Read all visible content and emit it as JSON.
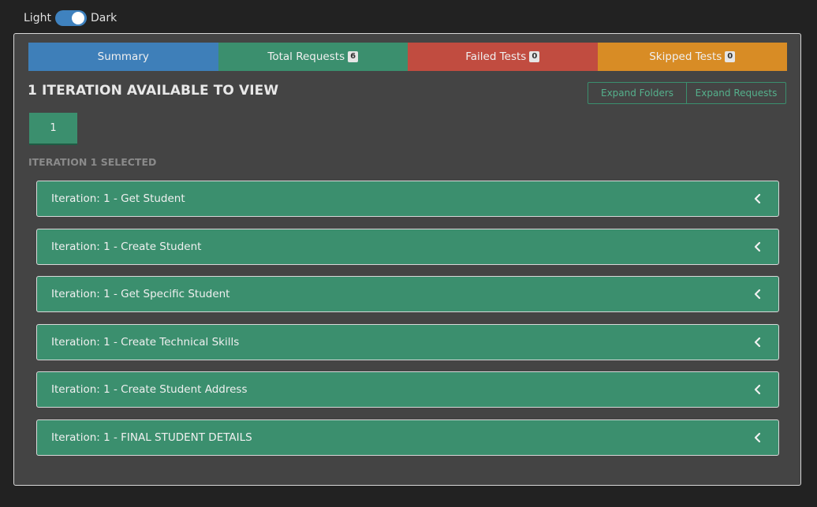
{
  "theme": {
    "light_label": "Light",
    "dark_label": "Dark",
    "dark_on": true
  },
  "tabs": {
    "summary": "Summary",
    "total_requests": "Total Requests",
    "total_requests_count": "6",
    "failed_tests": "Failed Tests",
    "failed_tests_count": "0",
    "skipped_tests": "Skipped Tests",
    "skipped_tests_count": "0"
  },
  "heading": "1 ITERATION AVAILABLE TO VIEW",
  "buttons": {
    "expand_folders": "Expand Folders",
    "expand_requests": "Expand Requests"
  },
  "iteration_tabs": [
    "1"
  ],
  "selected_label": "ITERATION 1 SELECTED",
  "requests": [
    "Iteration: 1 - Get Student",
    "Iteration: 1 - Create Student",
    "Iteration: 1 - Get Specific Student",
    "Iteration: 1 - Create Technical Skills",
    "Iteration: 1 - Create Student Address",
    "Iteration: 1 - FINAL STUDENT DETAILS"
  ],
  "icons": {
    "request_toggle": "chevron-left-icon"
  },
  "colors": {
    "summary": "#3e7fb9",
    "success": "#3b8f6e",
    "failed": "#c14c40",
    "skipped": "#d88c25",
    "background": "#222222",
    "card": "#444444"
  }
}
